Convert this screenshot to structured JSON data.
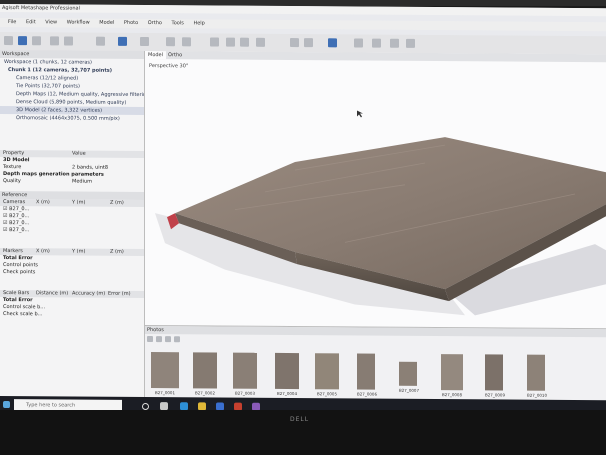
{
  "window": {
    "title": "Agisoft Metashape Professional"
  },
  "menu": [
    "File",
    "Edit",
    "View",
    "Workflow",
    "Model",
    "Photo",
    "Ortho",
    "Tools",
    "Help"
  ],
  "workspace": {
    "header": "Workspace",
    "items": [
      {
        "label": "Workspace (1 chunks, 12 cameras)",
        "level": 0
      },
      {
        "label": "Chunk 1 (12 cameras, 32,707 points)",
        "level": 1
      },
      {
        "label": "Cameras (12/12 aligned)",
        "level": 2
      },
      {
        "label": "Tie Points (32,707 points)",
        "level": 2
      },
      {
        "label": "Depth Maps (12, Medium quality, Aggressive filtering)",
        "level": 2
      },
      {
        "label": "Dense Cloud (5,890 points, Medium quality)",
        "level": 2
      },
      {
        "label": "3D Model (2 faces, 3,322 vertices)",
        "level": 2,
        "selected": true
      },
      {
        "label": "Orthomosaic (4464x3075, 0.500 mm/pix)",
        "level": 2
      }
    ]
  },
  "properties": {
    "col_property": "Property",
    "col_value": "Value",
    "rows": [
      {
        "label": "3D Model",
        "value": ""
      },
      {
        "label": "Texture",
        "value": "2 bands, uint8"
      },
      {
        "label": "Depth maps generation parameters",
        "value": ""
      },
      {
        "label": "Quality",
        "value": "Medium"
      }
    ]
  },
  "reference": {
    "header": "Reference",
    "cols": [
      "Cameras",
      "X (m)",
      "Y (m)",
      "Z (m)"
    ],
    "rows": [
      "B27_0...",
      "B27_0...",
      "B27_0...",
      "B27_0..."
    ]
  },
  "markers": {
    "cols": [
      "Markers",
      "X (m)",
      "Y (m)",
      "Z (m)"
    ],
    "rows": [
      "Total Error",
      "Control points",
      "Check points"
    ]
  },
  "scalebars": {
    "cols": [
      "Scale Bars",
      "Distance (m)",
      "Accuracy (m)",
      "Error (m)"
    ],
    "rows": [
      "Total Error",
      "Control scale b...",
      "Check scale b..."
    ]
  },
  "viewport": {
    "tabs": [
      "Model",
      "Ortho"
    ],
    "projection": "Perspective 30°"
  },
  "photos": {
    "header": "Photos",
    "thumbs": [
      "B27_0001",
      "B27_0002",
      "B27_0003",
      "B27_0004",
      "B27_0005",
      "B27_0006",
      "B27_0007",
      "B27_0008",
      "B27_0009",
      "B27_0010"
    ]
  },
  "taskbar": {
    "search_placeholder": "Type here to search"
  },
  "monitor": {
    "brand": "DELL"
  }
}
